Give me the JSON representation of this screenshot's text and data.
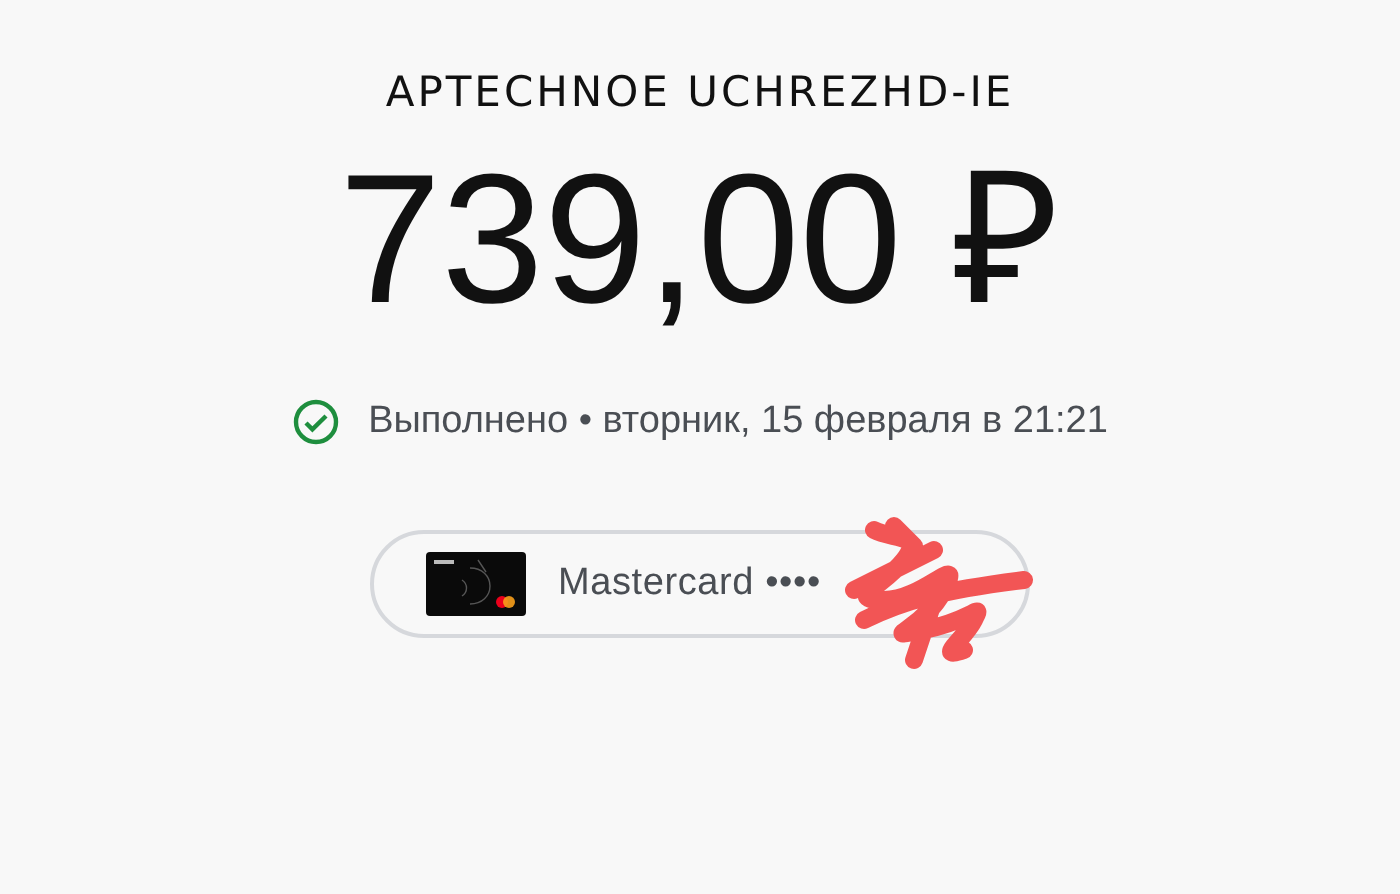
{
  "merchant": "APTECHNOE UCHREZHD-IE",
  "amount": "739,00 ₽",
  "status": {
    "kind": "completed",
    "text": "Выполнено • вторник, 15 февраля в 21:21"
  },
  "payment_method": {
    "label": "Mastercard ••••",
    "redacted": true
  }
}
